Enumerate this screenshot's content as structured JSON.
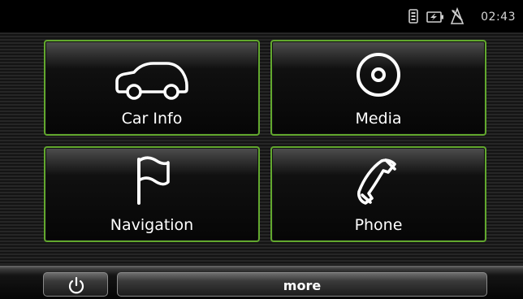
{
  "status_bar": {
    "icons": [
      "sim-card-icon",
      "battery-icon",
      "satellite-icon"
    ],
    "time": "02:43"
  },
  "menu": {
    "tiles": [
      {
        "label": "Car Info",
        "icon": "car-icon"
      },
      {
        "label": "Media",
        "icon": "disc-icon"
      },
      {
        "label": "Navigation",
        "icon": "flag-icon"
      },
      {
        "label": "Phone",
        "icon": "phone-icon"
      }
    ]
  },
  "bottom_bar": {
    "power_icon": "power-icon",
    "more_label": "more"
  },
  "colors": {
    "tile_border": "#62a82e",
    "label_text": "#ffffff",
    "background": "#1e1e1e"
  }
}
